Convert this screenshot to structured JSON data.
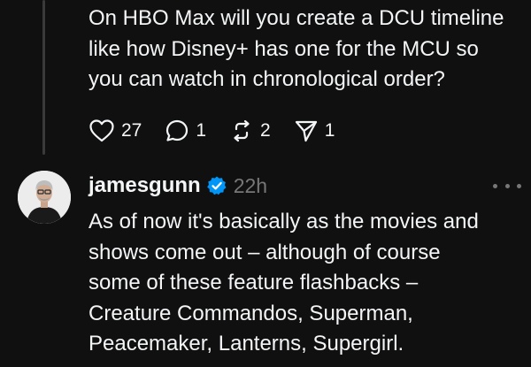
{
  "reply_post": {
    "text": "On HBO Max will you create a DCU timeline\nlike how Disney+ has one for the MCU so\nyou can watch in chronological order?",
    "actions": {
      "likes": "27",
      "replies": "1",
      "reposts": "2",
      "shares": "1"
    }
  },
  "author_post": {
    "username": "jamesgunn",
    "verified": true,
    "timestamp": "22h",
    "text": "As of now it's basically as the movies and\nshows come out – although of course\nsome of these feature flashbacks –\nCreature Commandos, Superman,\nPeacemaker, Lanterns, Supergirl."
  },
  "icons": {
    "like": "heart-icon",
    "reply": "comment-icon",
    "repost": "repost-icon",
    "share": "send-icon",
    "verified": "verified-badge-icon",
    "more": "more-icon"
  },
  "colors": {
    "background": "#101010",
    "text": "#f3f5f7",
    "muted": "#777777",
    "verified": "#0095f6",
    "thread_line": "#3a3a3a"
  }
}
